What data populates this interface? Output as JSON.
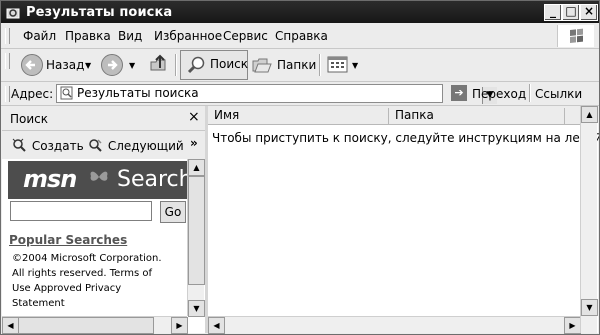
{
  "window": {
    "title": "Результаты поиска"
  },
  "menubar": {
    "items": [
      "Файл",
      "Правка",
      "Вид",
      "Избранное",
      "Сервис",
      "Справка"
    ]
  },
  "toolbar": {
    "back_label": "Назад",
    "search_label": "Поиск",
    "folders_label": "Папки"
  },
  "addressbar": {
    "label": "Адрес:",
    "value": "Результаты поиска",
    "go_label": "Переход",
    "links_label": "Ссылки"
  },
  "search_pane": {
    "title": "Поиск",
    "create_label": "Создать",
    "next_label": "Следующий",
    "msn_logo": "msn",
    "msn_search": "Search",
    "go_button": "Go",
    "popular_searches": "Popular Searches",
    "copyright": "©2004 Microsoft Corporation. All rights reserved.     Terms of Use     Approved Privacy Statement"
  },
  "results": {
    "columns": [
      "Имя",
      "Папка"
    ],
    "message": "Чтобы приступить к поиску, следуйте инструкциям на левой панели."
  },
  "icons": [
    "app-icon",
    "windows-logo-icon",
    "back-icon",
    "forward-icon",
    "up-folder-icon",
    "search-icon",
    "folders-icon",
    "views-icon",
    "address-page-icon",
    "go-arrow-icon",
    "create-search-icon",
    "next-search-icon",
    "close-icon",
    "chevron-icon",
    "msn-butterfly-icon"
  ]
}
